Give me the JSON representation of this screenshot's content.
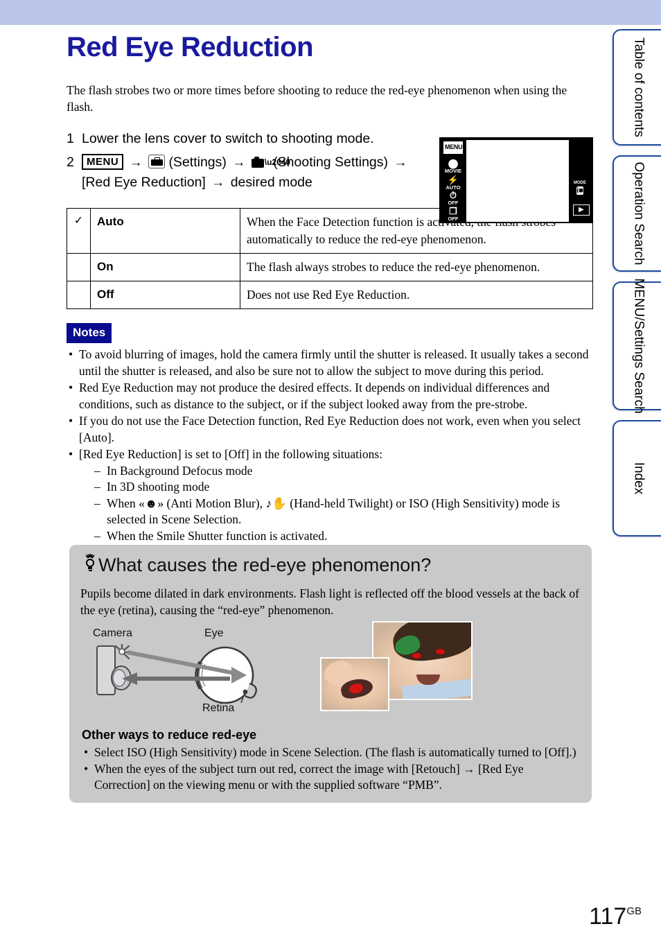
{
  "banner": {
    "color": "#b9c6ea"
  },
  "side_tabs": [
    {
      "label": "Table of contents"
    },
    {
      "label": "Operation Search"
    },
    {
      "label": "MENU/Settings Search"
    },
    {
      "label": "Index"
    }
  ],
  "page_title": "Red Eye Reduction",
  "intro": "The flash strobes two or more times before shooting to reduce the red-eye phenomenon when using the flash.",
  "steps": [
    {
      "num": "1",
      "text": "Lower the lens cover to switch to shooting mode."
    },
    {
      "num": "2",
      "menu_chip": "MENU",
      "arrow": "→",
      "settings_label": "(Settings)",
      "shooting_label": "(Shooting Settings)",
      "target": "[Red Eye Reduction]",
      "tail": "desired mode"
    }
  ],
  "lcd": {
    "menu_button": "MENU",
    "left_icons": [
      {
        "glyph": "⬤",
        "label": "MOVIE"
      },
      {
        "glyph": "⚡",
        "label": "AUTO"
      },
      {
        "glyph": "⏱",
        "label": "OFF"
      },
      {
        "glyph": "❐",
        "label": "OFF"
      }
    ],
    "mode_label": "MODE",
    "mode_glyph": "i■",
    "play_glyph": "▶"
  },
  "options_table": {
    "rows": [
      {
        "check": "✓",
        "name": "Auto",
        "desc": "When the Face Detection function is activated, the flash strobes automatically to reduce the red-eye phenomenon."
      },
      {
        "check": "",
        "name": "On",
        "desc": "The flash always strobes to reduce the red-eye phenomenon."
      },
      {
        "check": "",
        "name": "Off",
        "desc": "Does not use Red Eye Reduction."
      }
    ]
  },
  "notes": {
    "badge": "Notes",
    "items": [
      "To avoid blurring of images, hold the camera firmly until the shutter is released. It usually takes a second until the shutter is released, and also be sure not to allow the subject to move during this period.",
      "Red Eye Reduction may not produce the desired effects. It depends on individual differences and conditions, such as distance to the subject, or if the subject looked away from the pre-strobe.",
      "If you do not use the Face Detection function, Red Eye Reduction does not work, even when you select [Auto].",
      "[Red Eye Reduction] is set to [Off] in the following situations:"
    ],
    "sub_items_prefix": "When ",
    "sub_items": [
      "In Background Defocus mode",
      "In 3D shooting mode",
      "When «☻» (Anti Motion Blur), ♪✋ (Hand-held Twilight) or ISO (High Sensitivity) mode is selected in Scene Selection.",
      "When the Smile Shutter function is activated."
    ]
  },
  "tip": {
    "title": "What causes the red-eye phenomenon?",
    "paragraph": "Pupils become dilated in dark environments. Flash light is reflected off the blood vessels at the back of the eye (retina), causing the “red-eye” phenomenon.",
    "diagram": {
      "camera_label": "Camera",
      "eye_label": "Eye",
      "retina_label": "Retina"
    },
    "subtitle": "Other ways to reduce red-eye",
    "bullets": [
      "Select ISO (High Sensitivity) mode in Scene Selection. (The flash is automatically turned to [Off].)",
      "When the eyes of the subject turn out red, correct the image with [Retouch] → [Red Eye Correction] on the viewing menu or with the supplied software “PMB”."
    ]
  },
  "footer": {
    "page_number": "117",
    "page_suffix": "GB"
  }
}
